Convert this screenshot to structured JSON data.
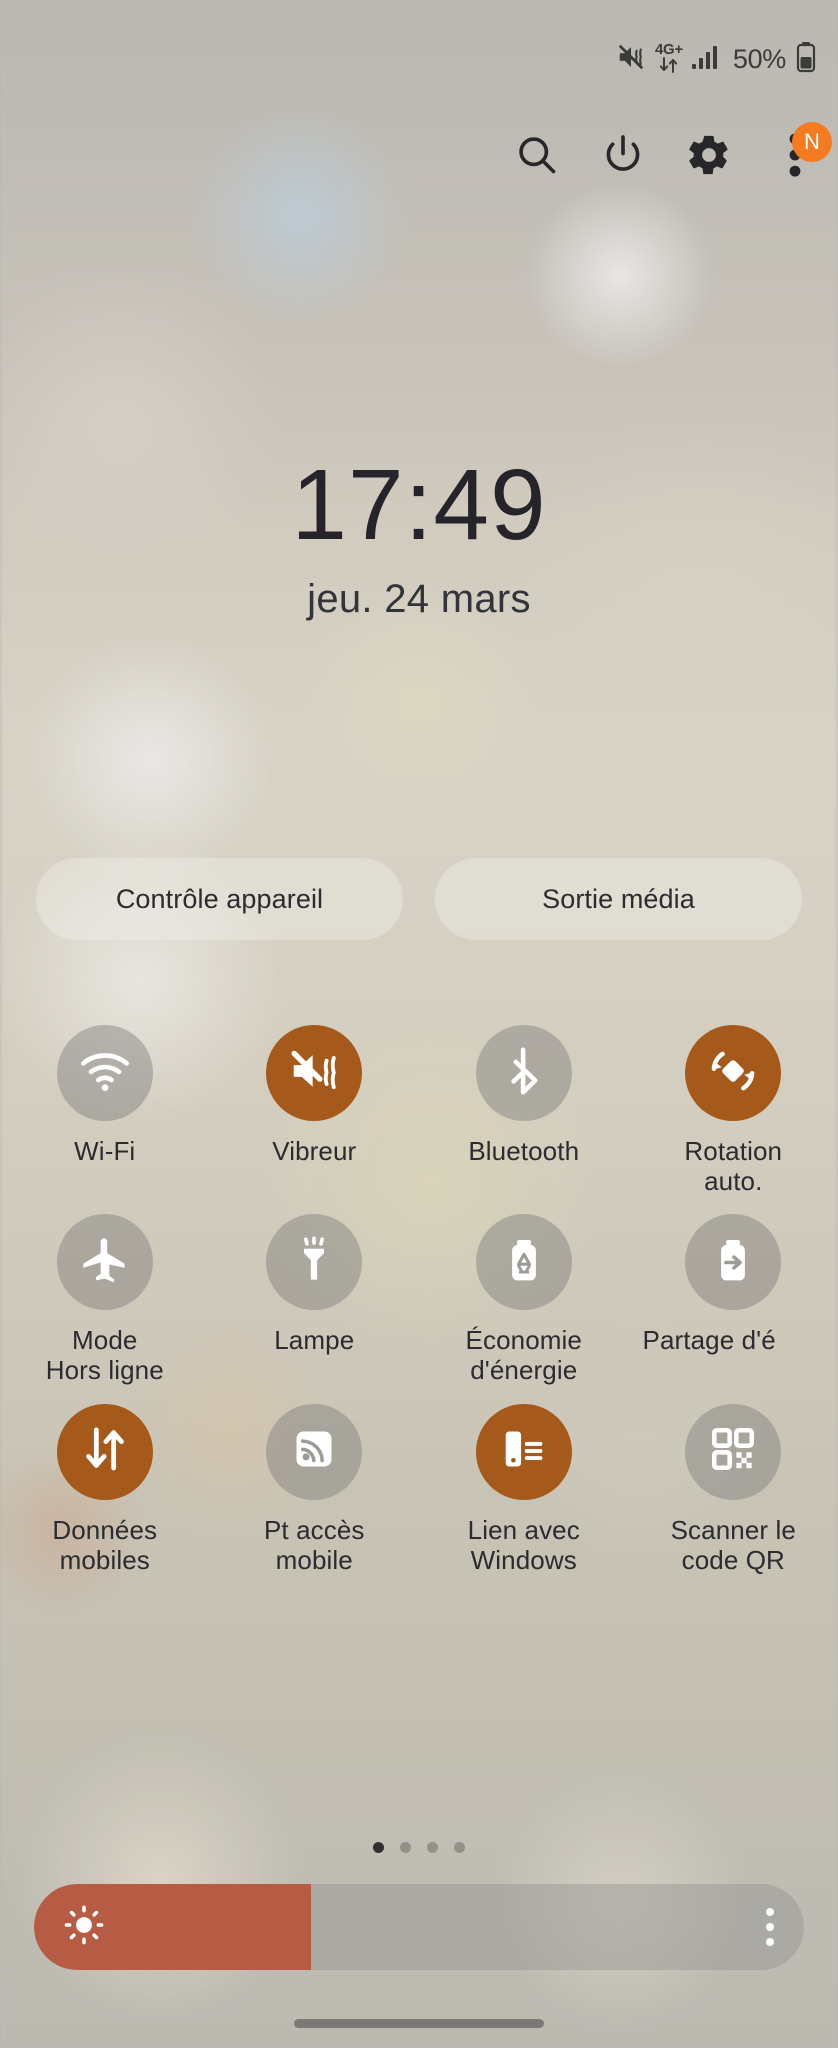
{
  "status_bar": {
    "ringer_icon": "vibrate-icon",
    "network_type": "4G+",
    "data_arrows_icon": "data-transfer-icon",
    "signal_icon": "signal-bars-icon",
    "battery_percent": "50%",
    "battery_icon": "battery-icon"
  },
  "header": {
    "actions": [
      {
        "name": "search",
        "icon": "search-icon",
        "label": "Rechercher"
      },
      {
        "name": "power",
        "icon": "power-icon",
        "label": "Marche/Arrêt"
      },
      {
        "name": "settings",
        "icon": "gear-icon",
        "label": "Paramètres"
      },
      {
        "name": "more",
        "icon": "more-vertical-icon",
        "label": "Plus",
        "badge": "N"
      }
    ]
  },
  "clock": {
    "time": "17:49",
    "date": "jeu. 24 mars"
  },
  "pills": [
    {
      "label": "Contrôle appareil"
    },
    {
      "label": "Sortie média"
    }
  ],
  "toggles": [
    [
      {
        "label": "Wi-Fi",
        "icon": "wifi-icon",
        "state": "off"
      },
      {
        "label": "Vibreur",
        "icon": "vibrate-icon",
        "state": "on"
      },
      {
        "label": "Bluetooth",
        "icon": "bluetooth-icon",
        "state": "off"
      },
      {
        "label": "Rotation\nauto.",
        "icon": "auto-rotate-icon",
        "state": "on"
      }
    ],
    [
      {
        "label": "Mode\nHors ligne",
        "icon": "airplane-icon",
        "state": "off"
      },
      {
        "label": "Lampe",
        "icon": "flashlight-icon",
        "state": "off"
      },
      {
        "label": "Économie\nd'énergie",
        "icon": "power-saving-icon",
        "state": "off"
      },
      {
        "label": "Partage d'é",
        "icon": "power-sharing-icon",
        "state": "off",
        "clipped": true
      }
    ],
    [
      {
        "label": "Données\nmobiles",
        "icon": "mobile-data-icon",
        "state": "on"
      },
      {
        "label": "Pt accès\nmobile",
        "icon": "hotspot-icon",
        "state": "off"
      },
      {
        "label": "Lien avec\nWindows",
        "icon": "link-to-windows-icon",
        "state": "on"
      },
      {
        "label": "Scanner le\ncode QR",
        "icon": "qr-code-icon",
        "state": "off"
      }
    ]
  ],
  "pager": {
    "total": 4,
    "active_index": 0
  },
  "brightness": {
    "icon": "brightness-sun-icon",
    "percent": 36,
    "more_icon": "more-vertical-icon"
  },
  "colors": {
    "accent_on": "#a55a1c",
    "accent_off": "rgba(120,120,118,0.42)",
    "brightness_fill": "#b75c44",
    "badge": "#f47b20"
  },
  "nav": {
    "handle": "home-gesture-handle"
  }
}
